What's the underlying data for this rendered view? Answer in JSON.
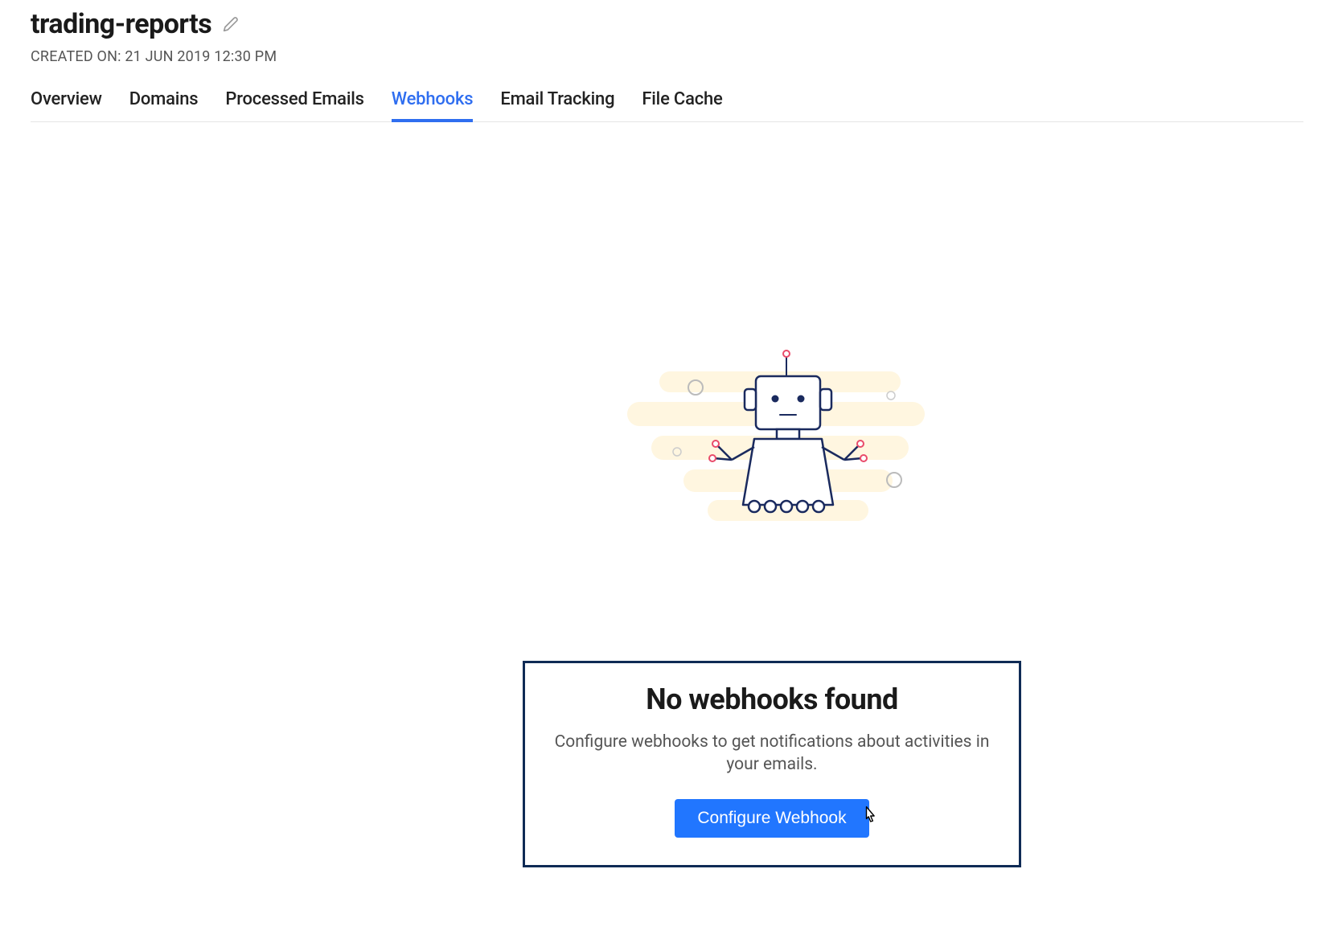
{
  "header": {
    "title": "trading-reports",
    "created_label": "CREATED ON: 21 JUN 2019 12:30 PM"
  },
  "tabs": [
    {
      "label": "Overview",
      "active": false
    },
    {
      "label": "Domains",
      "active": false
    },
    {
      "label": "Processed Emails",
      "active": false
    },
    {
      "label": "Webhooks",
      "active": true
    },
    {
      "label": "Email Tracking",
      "active": false
    },
    {
      "label": "File Cache",
      "active": false
    }
  ],
  "empty_state": {
    "title": "No webhooks found",
    "description": "Configure webhooks to get notifications about activities in your emails.",
    "button_label": "Configure Webhook"
  }
}
